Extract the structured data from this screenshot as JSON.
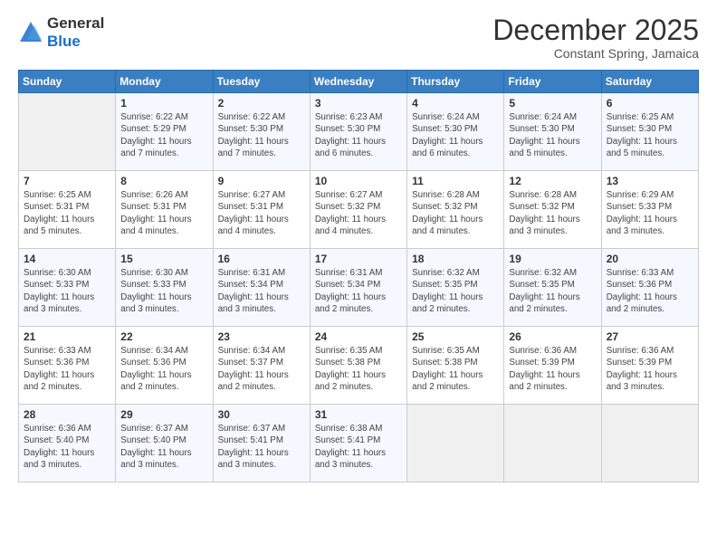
{
  "header": {
    "logo": {
      "line1": "General",
      "line2": "Blue"
    },
    "month": "December 2025",
    "location": "Constant Spring, Jamaica"
  },
  "weekdays": [
    "Sunday",
    "Monday",
    "Tuesday",
    "Wednesday",
    "Thursday",
    "Friday",
    "Saturday"
  ],
  "weeks": [
    [
      {
        "day": "",
        "empty": true
      },
      {
        "day": "1",
        "sunrise": "6:22 AM",
        "sunset": "5:29 PM",
        "daylight": "11 hours and 7 minutes."
      },
      {
        "day": "2",
        "sunrise": "6:22 AM",
        "sunset": "5:30 PM",
        "daylight": "11 hours and 7 minutes."
      },
      {
        "day": "3",
        "sunrise": "6:23 AM",
        "sunset": "5:30 PM",
        "daylight": "11 hours and 6 minutes."
      },
      {
        "day": "4",
        "sunrise": "6:24 AM",
        "sunset": "5:30 PM",
        "daylight": "11 hours and 6 minutes."
      },
      {
        "day": "5",
        "sunrise": "6:24 AM",
        "sunset": "5:30 PM",
        "daylight": "11 hours and 5 minutes."
      },
      {
        "day": "6",
        "sunrise": "6:25 AM",
        "sunset": "5:30 PM",
        "daylight": "11 hours and 5 minutes."
      }
    ],
    [
      {
        "day": "7",
        "sunrise": "6:25 AM",
        "sunset": "5:31 PM",
        "daylight": "11 hours and 5 minutes."
      },
      {
        "day": "8",
        "sunrise": "6:26 AM",
        "sunset": "5:31 PM",
        "daylight": "11 hours and 4 minutes."
      },
      {
        "day": "9",
        "sunrise": "6:27 AM",
        "sunset": "5:31 PM",
        "daylight": "11 hours and 4 minutes."
      },
      {
        "day": "10",
        "sunrise": "6:27 AM",
        "sunset": "5:32 PM",
        "daylight": "11 hours and 4 minutes."
      },
      {
        "day": "11",
        "sunrise": "6:28 AM",
        "sunset": "5:32 PM",
        "daylight": "11 hours and 4 minutes."
      },
      {
        "day": "12",
        "sunrise": "6:28 AM",
        "sunset": "5:32 PM",
        "daylight": "11 hours and 3 minutes."
      },
      {
        "day": "13",
        "sunrise": "6:29 AM",
        "sunset": "5:33 PM",
        "daylight": "11 hours and 3 minutes."
      }
    ],
    [
      {
        "day": "14",
        "sunrise": "6:30 AM",
        "sunset": "5:33 PM",
        "daylight": "11 hours and 3 minutes."
      },
      {
        "day": "15",
        "sunrise": "6:30 AM",
        "sunset": "5:33 PM",
        "daylight": "11 hours and 3 minutes."
      },
      {
        "day": "16",
        "sunrise": "6:31 AM",
        "sunset": "5:34 PM",
        "daylight": "11 hours and 3 minutes."
      },
      {
        "day": "17",
        "sunrise": "6:31 AM",
        "sunset": "5:34 PM",
        "daylight": "11 hours and 2 minutes."
      },
      {
        "day": "18",
        "sunrise": "6:32 AM",
        "sunset": "5:35 PM",
        "daylight": "11 hours and 2 minutes."
      },
      {
        "day": "19",
        "sunrise": "6:32 AM",
        "sunset": "5:35 PM",
        "daylight": "11 hours and 2 minutes."
      },
      {
        "day": "20",
        "sunrise": "6:33 AM",
        "sunset": "5:36 PM",
        "daylight": "11 hours and 2 minutes."
      }
    ],
    [
      {
        "day": "21",
        "sunrise": "6:33 AM",
        "sunset": "5:36 PM",
        "daylight": "11 hours and 2 minutes."
      },
      {
        "day": "22",
        "sunrise": "6:34 AM",
        "sunset": "5:36 PM",
        "daylight": "11 hours and 2 minutes."
      },
      {
        "day": "23",
        "sunrise": "6:34 AM",
        "sunset": "5:37 PM",
        "daylight": "11 hours and 2 minutes."
      },
      {
        "day": "24",
        "sunrise": "6:35 AM",
        "sunset": "5:38 PM",
        "daylight": "11 hours and 2 minutes."
      },
      {
        "day": "25",
        "sunrise": "6:35 AM",
        "sunset": "5:38 PM",
        "daylight": "11 hours and 2 minutes."
      },
      {
        "day": "26",
        "sunrise": "6:36 AM",
        "sunset": "5:39 PM",
        "daylight": "11 hours and 2 minutes."
      },
      {
        "day": "27",
        "sunrise": "6:36 AM",
        "sunset": "5:39 PM",
        "daylight": "11 hours and 3 minutes."
      }
    ],
    [
      {
        "day": "28",
        "sunrise": "6:36 AM",
        "sunset": "5:40 PM",
        "daylight": "11 hours and 3 minutes."
      },
      {
        "day": "29",
        "sunrise": "6:37 AM",
        "sunset": "5:40 PM",
        "daylight": "11 hours and 3 minutes."
      },
      {
        "day": "30",
        "sunrise": "6:37 AM",
        "sunset": "5:41 PM",
        "daylight": "11 hours and 3 minutes."
      },
      {
        "day": "31",
        "sunrise": "6:38 AM",
        "sunset": "5:41 PM",
        "daylight": "11 hours and 3 minutes."
      },
      {
        "day": "",
        "empty": true
      },
      {
        "day": "",
        "empty": true
      },
      {
        "day": "",
        "empty": true
      }
    ]
  ]
}
